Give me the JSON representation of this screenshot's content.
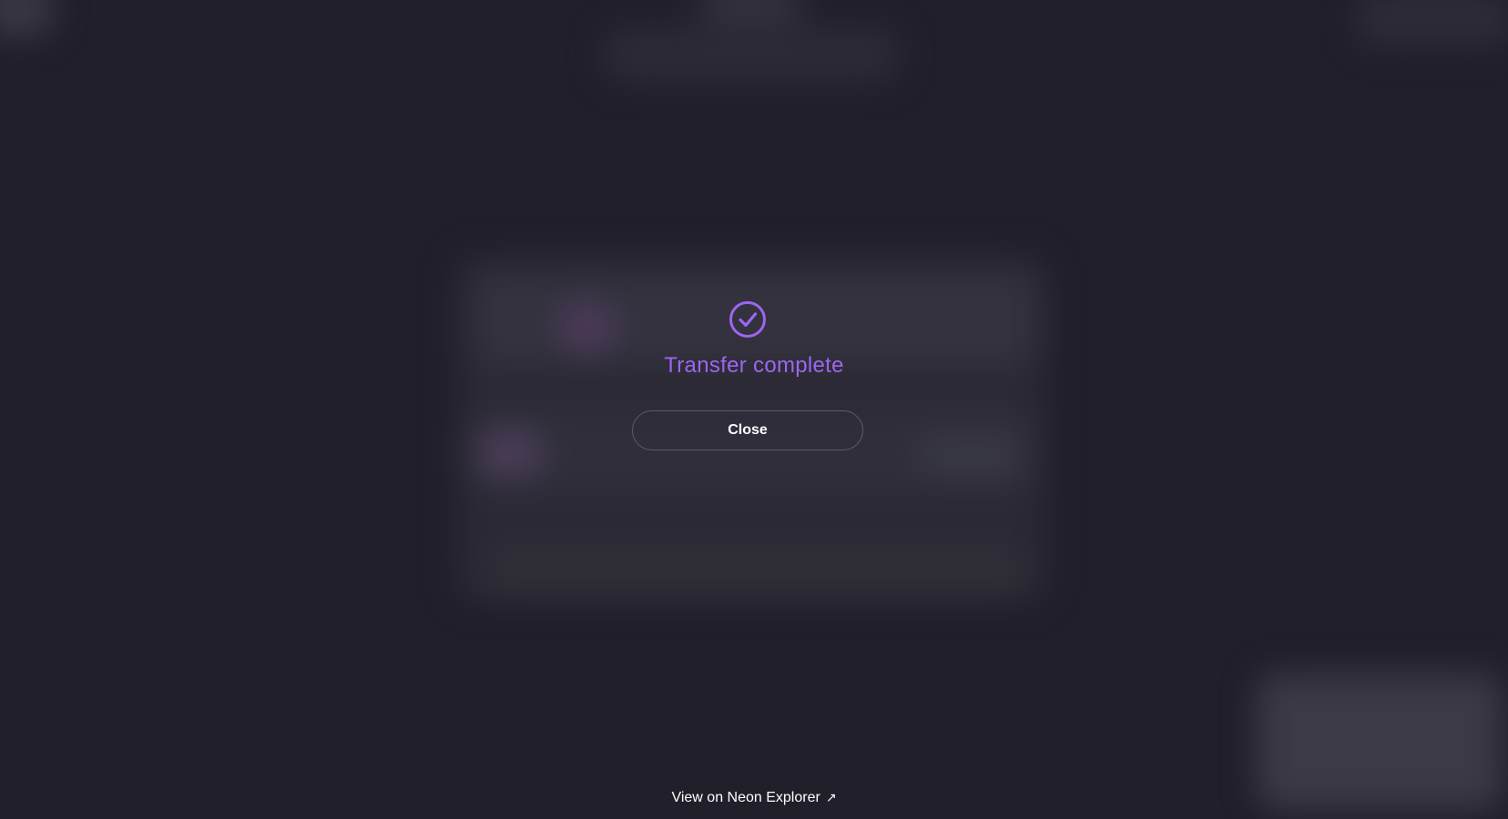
{
  "modal": {
    "title": "Transfer complete",
    "close_label": "Close",
    "icon": "check-circle-icon",
    "accent_color": "#9d66f0"
  },
  "footer": {
    "explorer_link_label": "View on Neon Explorer",
    "explorer_link_icon": "↗"
  },
  "colors": {
    "background": "#201f2a",
    "button_border": "#5d5b68"
  }
}
